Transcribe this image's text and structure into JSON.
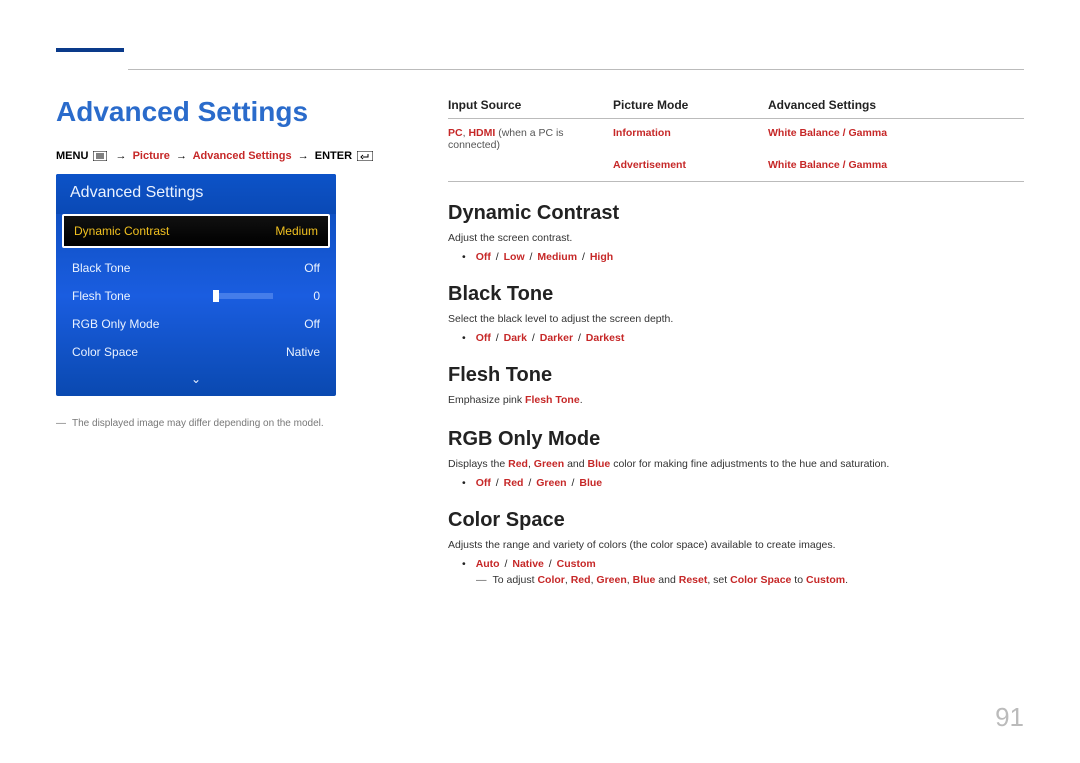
{
  "page": {
    "title": "Advanced Settings",
    "number": "91",
    "footnote": "The displayed image may differ depending on the model."
  },
  "path": {
    "menu": "MENU",
    "picture": "Picture",
    "adv": "Advanced Settings",
    "enter": "ENTER"
  },
  "tv_menu": {
    "header": "Advanced Settings",
    "highlighted": {
      "label": "Dynamic Contrast",
      "value": "Medium"
    },
    "rows": [
      {
        "label": "Black Tone",
        "value": "Off"
      },
      {
        "label": "Flesh Tone",
        "value": "0"
      },
      {
        "label": "RGB Only Mode",
        "value": "Off"
      },
      {
        "label": "Color Space",
        "value": "Native"
      }
    ]
  },
  "info_table": {
    "headers": {
      "h1": "Input Source",
      "h2": "Picture Mode",
      "h3": "Advanced Settings"
    },
    "row1": {
      "c1_a": "PC",
      "c1_b": "HDMI",
      "c1_tail": " (when a PC is connected)",
      "c2": "Information",
      "c3": "White Balance / Gamma"
    },
    "row2": {
      "c2": "Advertisement",
      "c3": "White Balance / Gamma"
    }
  },
  "sections": {
    "dynamic": {
      "h": "Dynamic Contrast",
      "desc": "Adjust the screen contrast.",
      "opts": [
        "Off",
        "Low",
        "Medium",
        "High"
      ]
    },
    "black": {
      "h": "Black Tone",
      "desc": "Select the black level to adjust the screen depth.",
      "opts": [
        "Off",
        "Dark",
        "Darker",
        "Darkest"
      ]
    },
    "flesh": {
      "h": "Flesh Tone",
      "desc_pre": "Emphasize pink ",
      "desc_red": "Flesh Tone",
      "desc_post": "."
    },
    "rgb": {
      "h": "RGB Only Mode",
      "desc_pre": "Displays the ",
      "w1": "Red",
      "w2": "Green",
      "w3": "Blue",
      "desc_mid": " and ",
      "desc_post": " color for making fine adjustments to the hue and saturation.",
      "opts": [
        "Off",
        "Red",
        "Green",
        "Blue"
      ]
    },
    "color": {
      "h": "Color Space",
      "desc": "Adjusts the range and variety of colors (the color space) available to create images.",
      "opts": [
        "Auto",
        "Native",
        "Custom"
      ],
      "note_pre": "To adjust ",
      "n1": "Color",
      "n2": "Red",
      "n3": "Green",
      "n4": "Blue",
      "note_and": " and ",
      "n5": "Reset",
      "note_set": ", set ",
      "n6": "Color Space",
      "note_to": " to ",
      "n7": "Custom",
      "note_post": "."
    }
  }
}
